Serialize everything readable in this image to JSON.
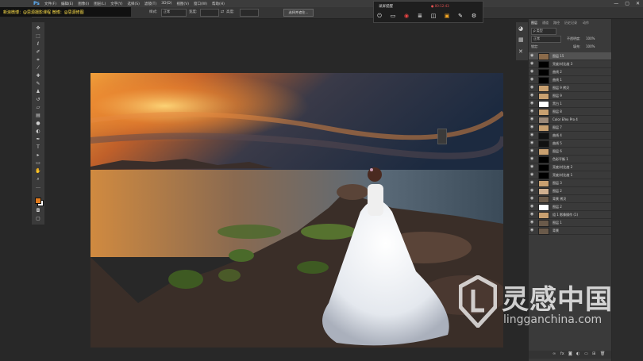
{
  "app": {
    "logo": "Ps"
  },
  "menu": [
    "文件(F)",
    "编辑(E)",
    "图像(I)",
    "图层(L)",
    "文字(Y)",
    "选择(S)",
    "滤镜(T)",
    "3D(D)",
    "视图(V)",
    "窗口(W)",
    "帮助(H)"
  ],
  "window_controls": [
    "—",
    "▢",
    "✕"
  ],
  "overlay_caption": "新浪微博：@思源摄影课程 微博：@思源修图",
  "options_bar": {
    "style_label": "样式:",
    "style_value": "正常",
    "width_label": "宽度:",
    "height_label": "高度:",
    "select_button": "选择并遮住..."
  },
  "recorder": {
    "title": "录屏提醒",
    "time": "● 00:12:43",
    "icons": [
      "power-icon",
      "chat-icon",
      "record-icon",
      "layers-icon",
      "camera-icon",
      "folder-icon",
      "brush-icon",
      "settings-icon"
    ]
  },
  "panel_tabs": [
    "图层",
    "通道",
    "路径",
    "历史记录",
    "动作"
  ],
  "layers_controls": {
    "kind_label": "ρ 类型",
    "blend_mode": "正常",
    "opacity_label": "不透明度:",
    "opacity_value": "100%",
    "lock_label": "锁定:",
    "fill_label": "填充:",
    "fill_value": "100%"
  },
  "layers": [
    {
      "name": "图层 15",
      "selected": true,
      "thumb": "#8a6a4a"
    },
    {
      "name": "亮度/对比度 3",
      "thumb": "#000000"
    },
    {
      "name": "曲线 2",
      "thumb": "#000000"
    },
    {
      "name": "曲线 1",
      "thumb": "#000000"
    },
    {
      "name": "图层 9 拷贝",
      "thumb": "#c8a070"
    },
    {
      "name": "图层 9",
      "thumb": "#c8a070"
    },
    {
      "name": "黑白 1",
      "thumb": "#ffffff"
    },
    {
      "name": "图层 8",
      "thumb": "#c8a070"
    },
    {
      "name": "Color Efex Pro 4",
      "thumb": "#9a8878"
    },
    {
      "name": "图层 7",
      "thumb": "#c8a070"
    },
    {
      "name": "曲线 4",
      "thumb": "#111111"
    },
    {
      "name": "曲线 5",
      "thumb": "#111111"
    },
    {
      "name": "图层 6",
      "thumb": "#c8a070"
    },
    {
      "name": "色彩平衡 1",
      "thumb": "#000000"
    },
    {
      "name": "亮度/对比度 2",
      "thumb": "#000000"
    },
    {
      "name": "亮度/对比度 1",
      "thumb": "#000000"
    },
    {
      "name": "图层 3",
      "thumb": "#c8a070"
    },
    {
      "name": "图层 2",
      "thumb": "#d0b090"
    },
    {
      "name": "背景 拷贝",
      "thumb": "#6a5a4a"
    },
    {
      "name": "图层 2",
      "thumb": "#ffffff"
    },
    {
      "name": "组 1 影像操作 (1)",
      "thumb": "#c8a070"
    },
    {
      "name": "图层 1",
      "thumb": "#6a5a4a"
    },
    {
      "name": "背景",
      "thumb": "#6a5a4a"
    }
  ],
  "watermark": {
    "cn": "灵感中国",
    "url": "lingganchina.com"
  }
}
